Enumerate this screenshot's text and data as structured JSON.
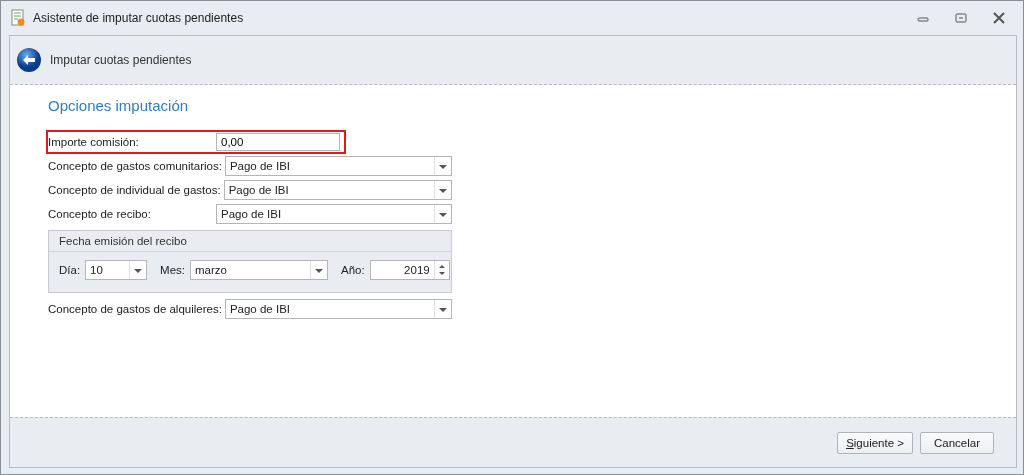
{
  "window": {
    "title": "Asistente de imputar cuotas pendientes"
  },
  "header": {
    "title": "Imputar cuotas pendientes"
  },
  "section_title": "Opciones imputación",
  "fields": [
    {
      "kind": "text",
      "label": "Importe comisión:",
      "value": "0,00",
      "highlighted": true
    },
    {
      "kind": "combo",
      "label": "Concepto de gastos comunitarios:",
      "value": "Pago de IBI",
      "highlighted": false
    },
    {
      "kind": "combo",
      "label": "Concepto de individual de gastos:",
      "value": "Pago de IBI",
      "highlighted": false
    },
    {
      "kind": "combo",
      "label": "Concepto de recibo:",
      "value": "Pago de IBI",
      "highlighted": false
    }
  ],
  "date_group": {
    "title": "Fecha emisión del recibo",
    "day_label": "Día:",
    "day": "10",
    "month_label": "Mes:",
    "month": "marzo",
    "year_label": "Año:",
    "year": "2019"
  },
  "fields_after": [
    {
      "kind": "combo",
      "label": "Concepto de gastos de alquileres:",
      "value": "Pago de IBI",
      "highlighted": false
    }
  ],
  "buttons": [
    {
      "label": "Siguiente >",
      "mnemonic_underlined": true
    },
    {
      "label": "Cancelar",
      "mnemonic_underlined": false
    }
  ]
}
